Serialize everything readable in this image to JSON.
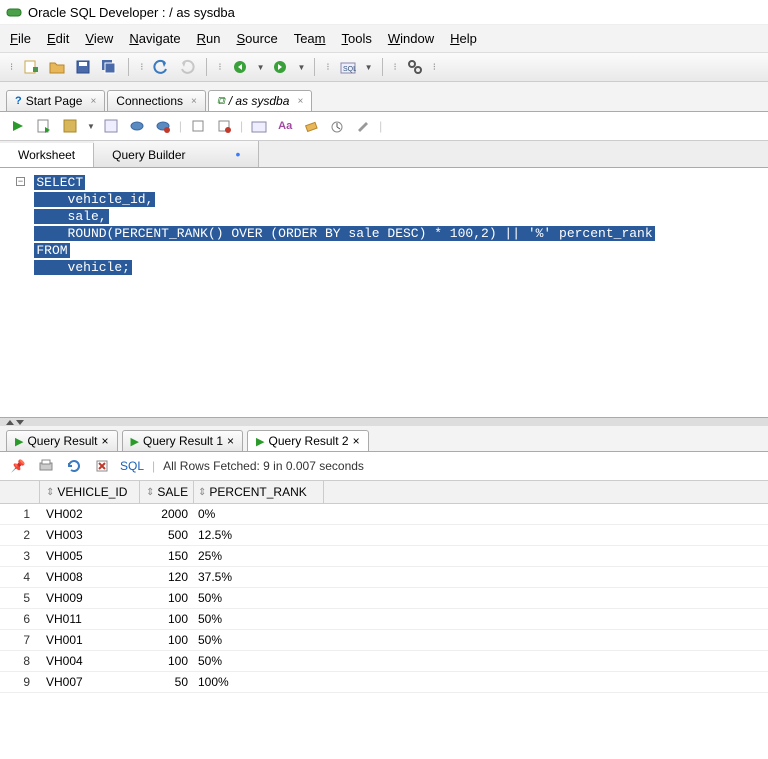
{
  "window": {
    "title": "Oracle SQL Developer : / as sysdba"
  },
  "menu": {
    "file": "File",
    "edit": "Edit",
    "view": "View",
    "navigate": "Navigate",
    "run": "Run",
    "source": "Source",
    "team": "Team",
    "tools": "Tools",
    "window": "Window",
    "help": "Help"
  },
  "tabs": {
    "start": "Start Page",
    "connections": "Connections",
    "worksheet": "/ as sysdba"
  },
  "editor_tabs": {
    "worksheet": "Worksheet",
    "query_builder": "Query Builder"
  },
  "sql": {
    "l1": "SELECT",
    "l2": "    vehicle_id,",
    "l3": "    sale,",
    "l4": "    ROUND(PERCENT_RANK() OVER (ORDER BY sale DESC) * 100,2) || '%' percent_rank",
    "l5": "FROM",
    "l6": "    vehicle;"
  },
  "result_tabs": {
    "r0": "Query Result",
    "r1": "Query Result 1",
    "r2": "Query Result 2"
  },
  "status": "All Rows Fetched: 9 in 0.007 seconds",
  "sql_link": "SQL",
  "columns": {
    "vehicle_id": "VEHICLE_ID",
    "sale": "SALE",
    "percent_rank": "PERCENT_RANK"
  },
  "rows": [
    {
      "n": "1",
      "vehicle_id": "VH002",
      "sale": "2000",
      "percent_rank": "0%"
    },
    {
      "n": "2",
      "vehicle_id": "VH003",
      "sale": "500",
      "percent_rank": "12.5%"
    },
    {
      "n": "3",
      "vehicle_id": "VH005",
      "sale": "150",
      "percent_rank": "25%"
    },
    {
      "n": "4",
      "vehicle_id": "VH008",
      "sale": "120",
      "percent_rank": "37.5%"
    },
    {
      "n": "5",
      "vehicle_id": "VH009",
      "sale": "100",
      "percent_rank": "50%"
    },
    {
      "n": "6",
      "vehicle_id": "VH011",
      "sale": "100",
      "percent_rank": "50%"
    },
    {
      "n": "7",
      "vehicle_id": "VH001",
      "sale": "100",
      "percent_rank": "50%"
    },
    {
      "n": "8",
      "vehicle_id": "VH004",
      "sale": "100",
      "percent_rank": "50%"
    },
    {
      "n": "9",
      "vehicle_id": "VH007",
      "sale": "50",
      "percent_rank": "100%"
    }
  ]
}
